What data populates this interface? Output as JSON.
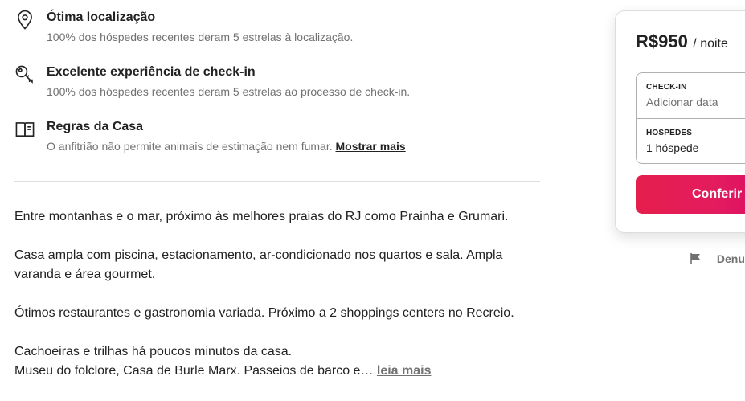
{
  "highlights": [
    {
      "icon": "map-pin-icon",
      "title": "Ótima localização",
      "subtitle": "100% dos hóspedes recentes deram 5 estrelas à localização."
    },
    {
      "icon": "key-icon",
      "title": "Excelente experiência de check-in",
      "subtitle": "100% dos hóspedes recentes deram 5 estrelas ao processo de check-in."
    },
    {
      "icon": "house-rules-book-icon",
      "title": "Regras da Casa",
      "subtitle": "O anfitrião não permite animais de estimação nem fumar.",
      "link": "Mostrar mais"
    }
  ],
  "description": {
    "paragraphs": [
      "Entre montanhas e o mar, próximo às melhores praias do RJ como Prainha e Grumari.",
      "Casa ampla com piscina, estacionamento, ar-condicionado nos quartos e sala. Ampla varanda e área gourmet.",
      "Ótimos restaurantes e gastronomia variada. Próximo a 2 shoppings centers no Recreio.",
      "Cachoeiras e trilhas há poucos minutos da casa."
    ],
    "last_line": "Museu do folclore, Casa de Burle Marx. Passeios de barco e…",
    "read_more": "leia mais"
  },
  "booking": {
    "price": "R$950",
    "per": "/ noite",
    "checkin_label": "CHECK-IN",
    "checkin_value": "Adicionar data",
    "guests_label": "HOSPEDES",
    "guests_value": "1 hóspede",
    "cta_label": "Conferir"
  },
  "report": {
    "icon": "flag-icon",
    "label": "Denunciar"
  },
  "colors": {
    "accent": "#e31c5f",
    "text": "#222222",
    "muted": "#717171",
    "divider": "#dddddd"
  }
}
